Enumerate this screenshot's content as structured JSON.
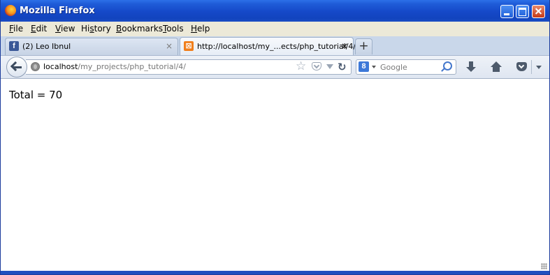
{
  "window": {
    "title": "Mozilla Firefox",
    "colors": {
      "titlebar": "#1548c8",
      "close_button": "#c63a18"
    }
  },
  "menubar": {
    "items": [
      {
        "accel": "F",
        "rest": "ile"
      },
      {
        "accel": "E",
        "rest": "dit"
      },
      {
        "accel": "V",
        "rest": "iew"
      },
      {
        "pre": "Hi",
        "accel": "s",
        "rest": "tory"
      },
      {
        "accel": "B",
        "rest": "ookmarks"
      },
      {
        "accel": "T",
        "rest": "ools"
      },
      {
        "accel": "H",
        "rest": "elp"
      }
    ]
  },
  "tabs": [
    {
      "label": "(2) Leo Ibnul",
      "close": "×",
      "favicon": "facebook-icon",
      "favicon_glyph": "f",
      "active": false
    },
    {
      "label": "http://localhost/my_...ects/php_tutorial/4/",
      "close": "×",
      "favicon": "xampp-icon",
      "favicon_glyph": "⊠",
      "active": true
    }
  ],
  "new_tab": {
    "label": "+"
  },
  "navbar": {
    "url_host": "localhost",
    "url_path": "/my_projects/php_tutorial/4/",
    "search_engine": "g-icon",
    "search_engine_glyph": "8",
    "search_placeholder": "Google",
    "star_glyph": "☆",
    "reload_glyph": "↻"
  },
  "page": {
    "text": "Total = 70"
  }
}
